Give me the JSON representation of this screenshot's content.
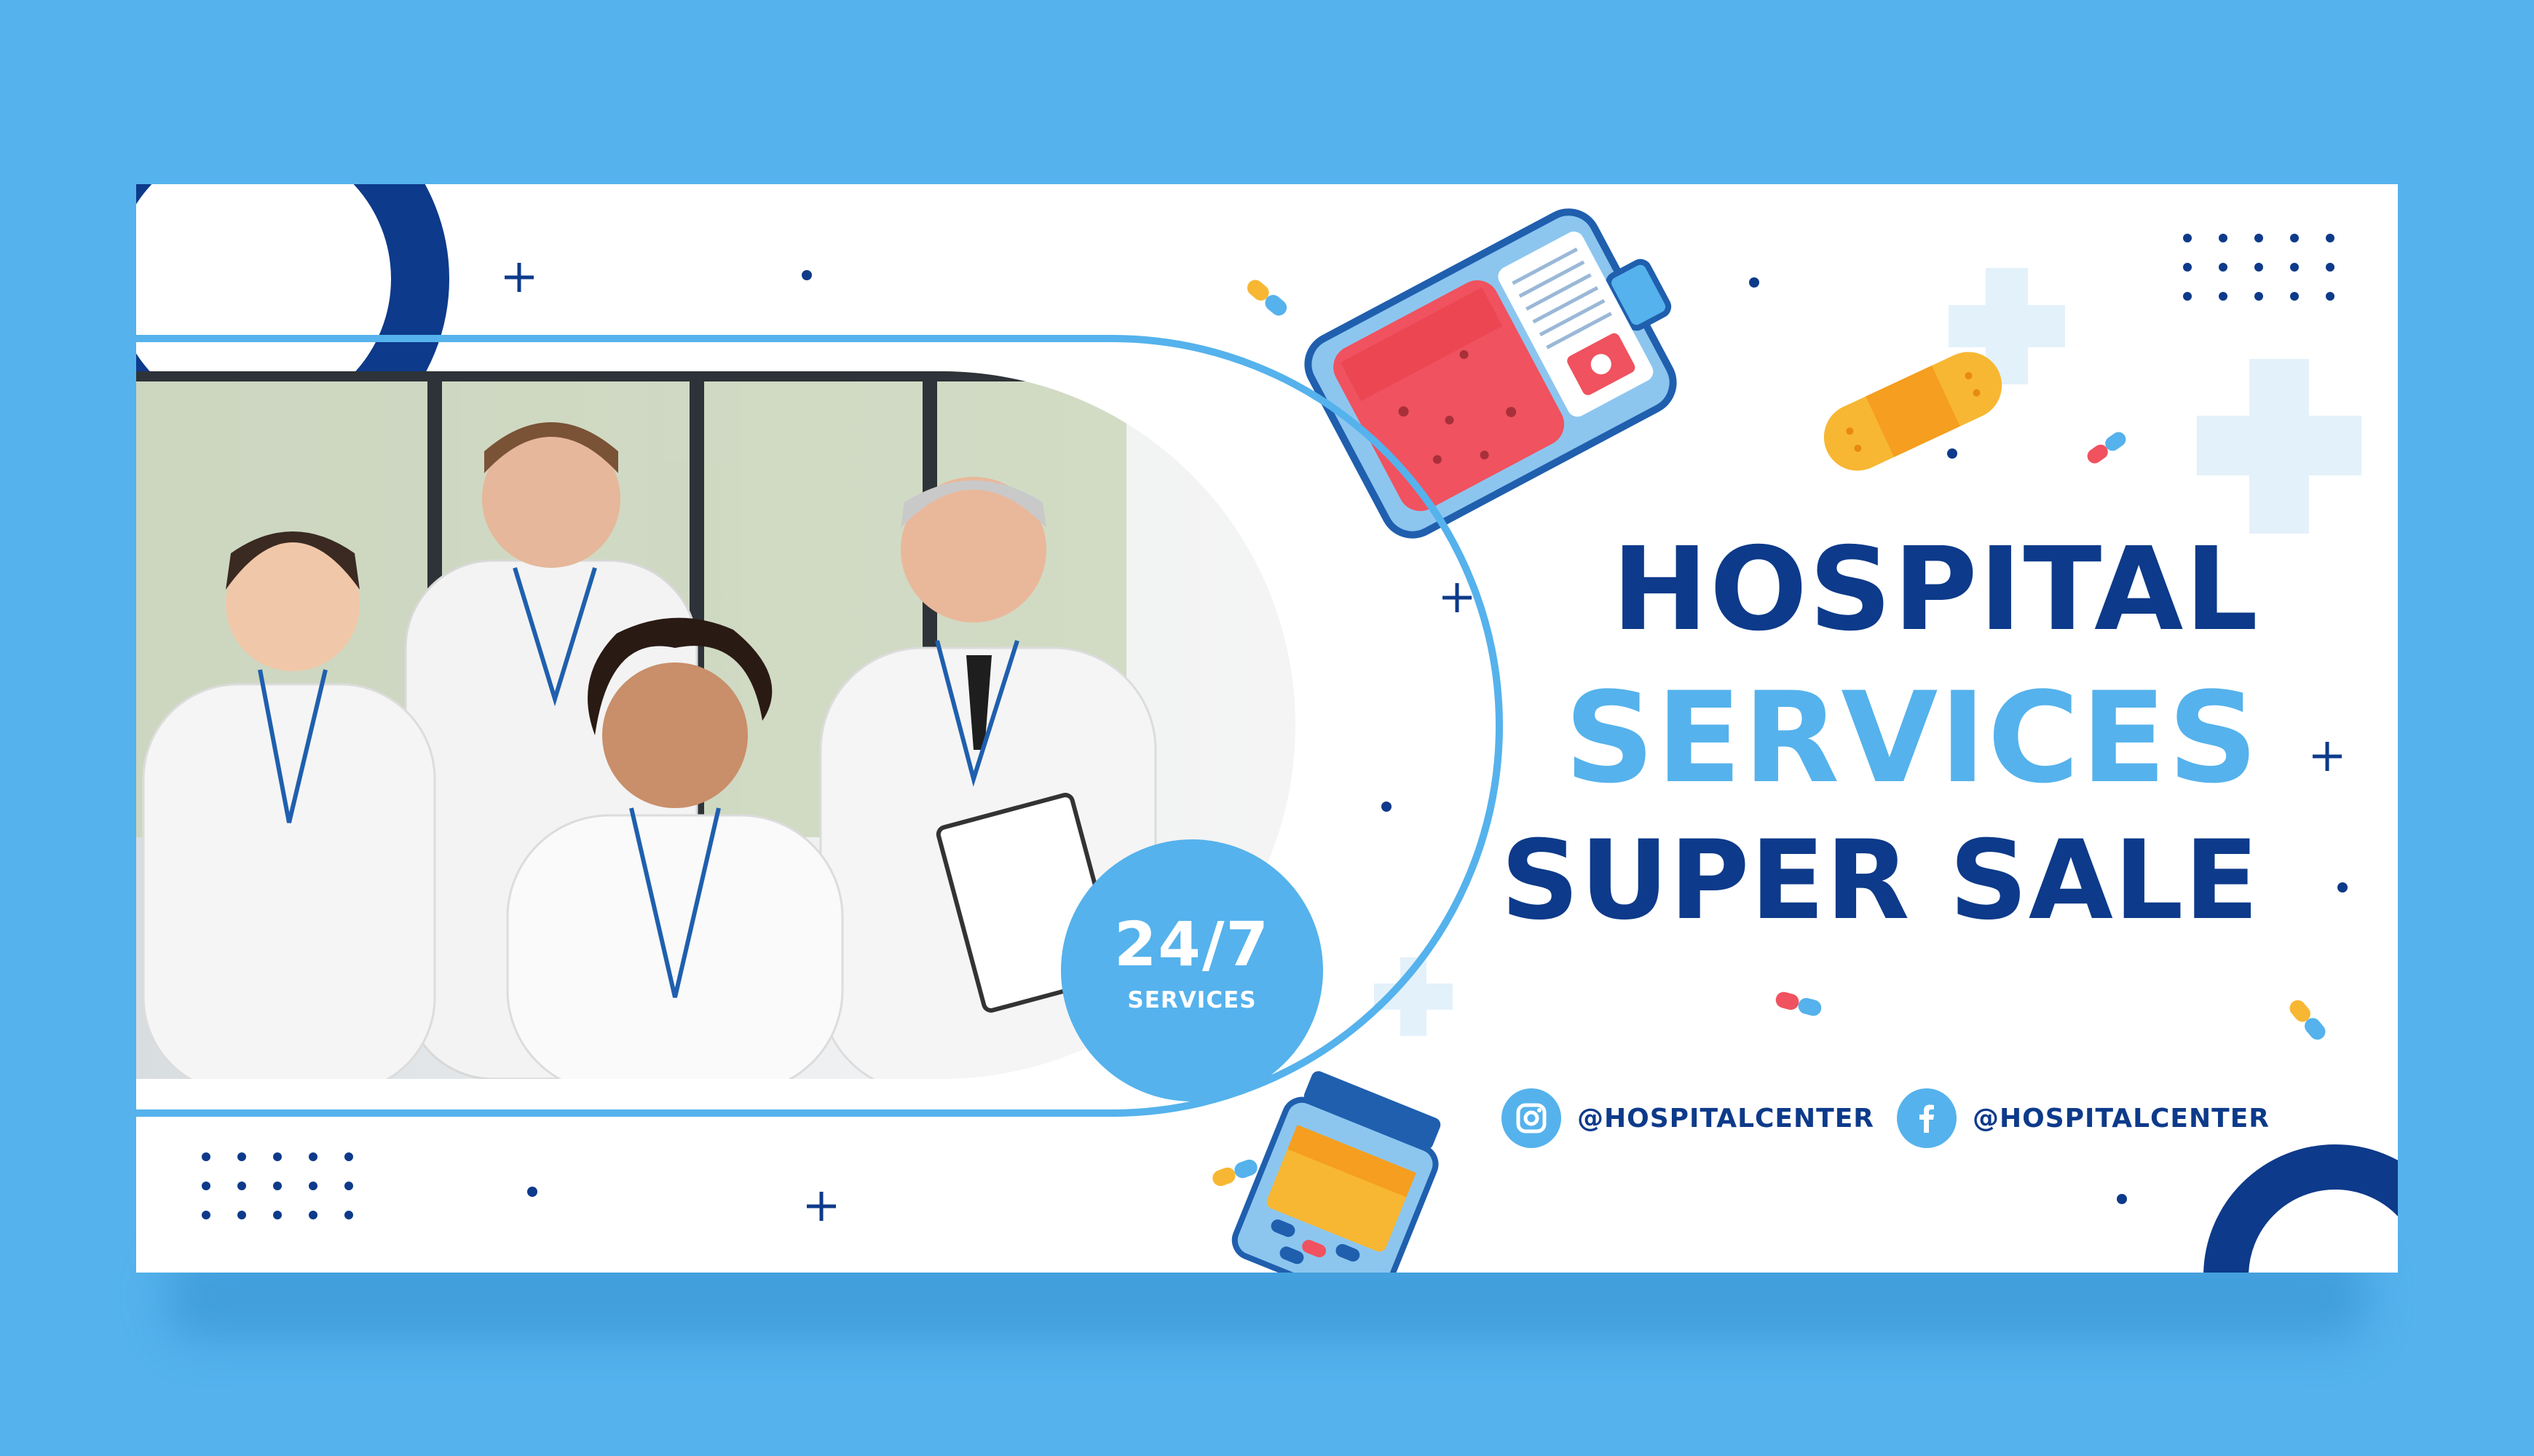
{
  "colors": {
    "background": "#55b2ec",
    "navy": "#0d3a8a",
    "accent_blue": "#55b2ec",
    "light_blue": "#e3f1fb",
    "white": "#ffffff"
  },
  "headline": {
    "line1": "HOSPITAL",
    "line2": "SERVICES",
    "line3": "SUPER SALE"
  },
  "badge": {
    "main": "24/7",
    "sub": "SERVICES"
  },
  "socials": [
    {
      "icon": "instagram-icon",
      "handle": "@HOSPITALCENTER"
    },
    {
      "icon": "facebook-icon",
      "handle": "@HOSPITALCENTER"
    }
  ],
  "decorations": {
    "icons": [
      "blood-bag-icon",
      "bandage-icon",
      "pill-bottle-icon",
      "pill-capsule-icon",
      "plus-icon",
      "medical-cross-icon",
      "dot-grid-icon",
      "ring-shape"
    ]
  },
  "photo": {
    "subject": "team-of-four-doctors-in-white-coats"
  }
}
